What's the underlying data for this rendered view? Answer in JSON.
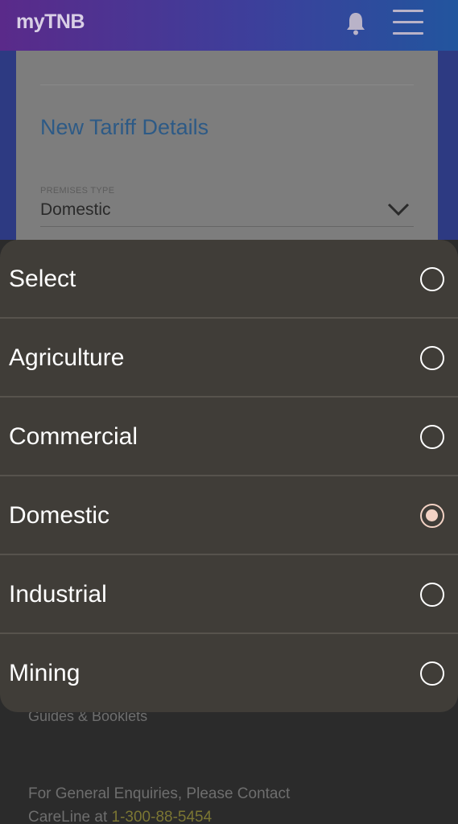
{
  "header": {
    "logo": "myTNB",
    "icons": [
      "bell-icon",
      "hamburger-menu-icon"
    ]
  },
  "card": {
    "title": "New Tariff Details",
    "premises_label": "PREMISES TYPE",
    "premises_value": "Domestic"
  },
  "dropdown": {
    "selected": "Domestic",
    "options": [
      {
        "label": "Select",
        "checked": false
      },
      {
        "label": "Agriculture",
        "checked": false
      },
      {
        "label": "Commercial",
        "checked": false
      },
      {
        "label": "Domestic",
        "checked": true
      },
      {
        "label": "Industrial",
        "checked": false
      },
      {
        "label": "Mining",
        "checked": false
      }
    ]
  },
  "footer": {
    "guides_link": "Guides & Booklets",
    "enquiries_line1": "For General Enquiries, Please Contact",
    "careline_prefix": "CareLine at ",
    "careline_number": "1-300-88-5454"
  },
  "colors": {
    "header_gradient_start": "#5a2a8a",
    "header_gradient_end": "#22559e",
    "sheet_background": "#403d38",
    "radio_selected": "#f3d2c4",
    "title_blue": "#2d5a86"
  }
}
